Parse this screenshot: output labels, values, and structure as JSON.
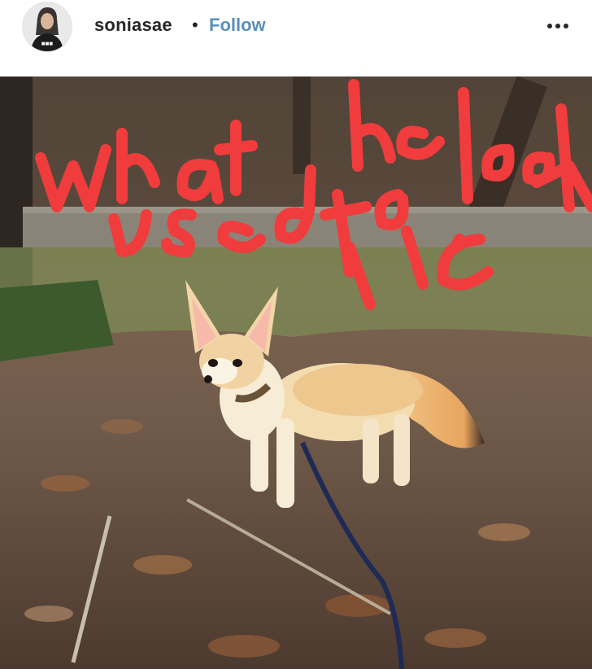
{
  "post": {
    "username": "soniasae",
    "separator": "•",
    "follow_label": "Follow"
  },
  "icons": {
    "more": "more-options-icon"
  },
  "image": {
    "subject": "fennec fox on leash in forest",
    "scribble_text": "what he used to look like"
  },
  "colors": {
    "follow": "#5b8fb9",
    "scribble": "#f03c3c",
    "username": "#262626"
  }
}
